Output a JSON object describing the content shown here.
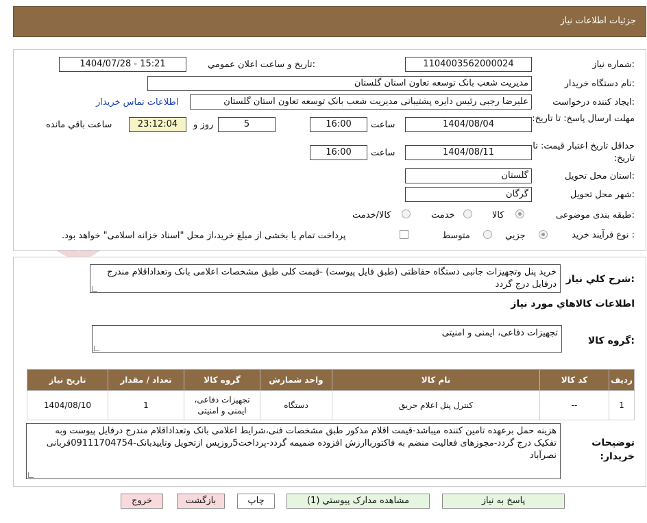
{
  "header": {
    "title": "جزئیات اطلاعات نیاز"
  },
  "form": {
    "need_number_label": "شماره نیاز:",
    "need_number": "1104003562000024",
    "announce_label": "تاریخ و ساعت اعلان عمومي:",
    "announce_value": "1404/07/28 - 15:21",
    "buyer_org_label": "نام دستگاه خریدار:",
    "buyer_org": "مدیریت شعب بانک توسعه تعاون استان گلستان",
    "requester_label": "ایجاد کننده درخواست:",
    "requester": "علیرضا رجبی رئیس دایره پشتیبانی مدیریت شعب بانک توسعه تعاون استان گلستان",
    "contact_link": "اطلاعات تماس خریدار",
    "send_deadline_label": "مهلت ارسال پاسخ: تا تاریخ:",
    "send_date": "1404/08/04",
    "time_label": "ساعت",
    "send_time": "16:00",
    "days_value": "5",
    "days_label": "روز و",
    "remaining_time": "23:12:04",
    "remaining_label": "ساعت باقي مانده",
    "validity_label": "حداقل تاریخ اعتبار قیمت: تا تاریخ:",
    "validity_date": "1404/08/11",
    "validity_time": "16:00",
    "province_label": "استان محل تحویل:",
    "province": "گلستان",
    "city_label": "شهر محل تحویل:",
    "city": "گرگان",
    "category_label": "طبقه بندی موضوعی:",
    "category_options": [
      "کالا",
      "خدمت",
      "کالا/خدمت"
    ],
    "process_label": "نوع فرآیند خرید :",
    "process_options": [
      "جزیي",
      "متوسط"
    ],
    "payment_note": "پرداخت تمام یا بخشی از مبلغ خرید،از محل \"اسناد خزانه اسلامی\" خواهد بود."
  },
  "summary": {
    "label": "شرح کلي نیاز:",
    "text": "خرید  پنل وتجهیزات جانبی دستگاه  حفاظتی (طبق فایل پیوست)  -قیمت کلی طبق مشخصات اعلامی بانک وتعداداقلام مندرج درفایل درج گردد",
    "items_title": "اطلاعات کالاهاي مورد نیاز",
    "group_label": "گروه کالا:",
    "group_value": "تجهیزات دفاعی، ایمنی و امنیتی"
  },
  "table": {
    "headers": [
      "ردیف",
      "کد کالا",
      "نام کالا",
      "واحد شمارش",
      "گروه کالا",
      "تعداد / مقدار",
      "تاریخ نیاز"
    ],
    "rows": [
      [
        "1",
        "--",
        "کنترل پنل اعلام حریق",
        "دستگاه",
        "تجهیزات دفاعی، ایمنی و امنیتی",
        "1",
        "1404/08/10"
      ]
    ]
  },
  "buyer_notes": {
    "label": "توضیحات خریدار:",
    "text": "هزینه حمل برعهده تامین کننده میباشد-قیمت اقلام مذکور طبق مشخصات فنی،شرایط اعلامی بانک وتعداداقلام مندرج درفایل پیوست وبه تفکیک درج گردد-مجوزهای فعالیت منضم به فاکتورباارزش افزوده ضمیمه گردد-پرداخت5روزپس ازتحویل وتاییدبانک-09111704754قربانی نصرآباد"
  },
  "buttons": {
    "reply": "پاسخ به نیاز",
    "view_docs": "مشاهده مدارک پیوستي (1)",
    "print": "چاپ",
    "back": "بازگشت",
    "exit": "خروج"
  },
  "colors": {
    "header": "#8c6a44",
    "link": "#1a3fb0",
    "highlight": "#f6f3c6"
  }
}
